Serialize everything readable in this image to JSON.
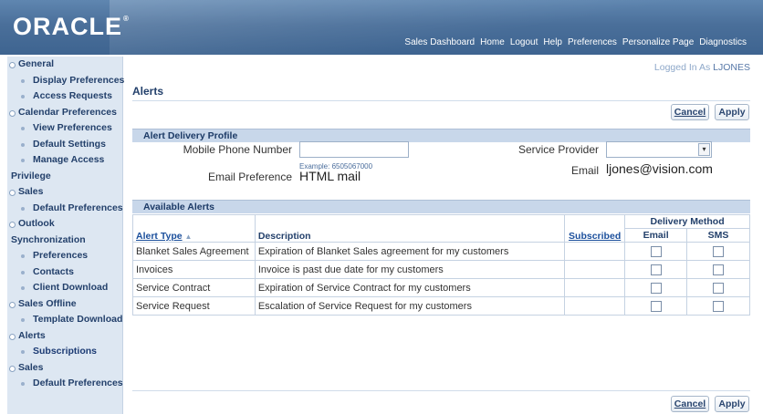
{
  "header": {
    "logo": "ORACLE",
    "logo_mark": "®",
    "nav": [
      "Sales Dashboard",
      "Home",
      "Logout",
      "Help",
      "Preferences",
      "Personalize Page",
      "Diagnostics"
    ]
  },
  "sidebar": {
    "items": [
      {
        "label": "General",
        "level": 1
      },
      {
        "label": "Display Preferences",
        "level": 2
      },
      {
        "label": "Access Requests",
        "level": 2
      },
      {
        "label": "Calendar Preferences",
        "level": 1
      },
      {
        "label": "View Preferences",
        "level": 2
      },
      {
        "label": "Default Settings",
        "level": 2
      },
      {
        "label": "Manage Access",
        "level": 2
      },
      {
        "label": "Privilege",
        "level": 0
      },
      {
        "label": "Sales",
        "level": 1
      },
      {
        "label": "Default Preferences",
        "level": 2
      },
      {
        "label": "Outlook",
        "level": 1
      },
      {
        "label": "Synchronization",
        "level": 0
      },
      {
        "label": "Preferences",
        "level": 2
      },
      {
        "label": "Contacts",
        "level": 2
      },
      {
        "label": "Client Download",
        "level": 2
      },
      {
        "label": "Sales Offline",
        "level": 1
      },
      {
        "label": "Template Download",
        "level": 2
      },
      {
        "label": "Alerts",
        "level": 1
      },
      {
        "label": "Subscriptions",
        "level": 2,
        "selected": true
      },
      {
        "label": "Sales",
        "level": 1
      },
      {
        "label": "Default Preferences",
        "level": 2
      }
    ]
  },
  "main": {
    "logged_in_prefix": "Logged In As ",
    "logged_in_user": "LJONES",
    "title": "Alerts",
    "cancel_label": "Cancel",
    "apply_label": "Apply",
    "delivery_profile": {
      "header": "Alert Delivery Profile",
      "mobile_label": "Mobile Phone Number",
      "mobile_value": "",
      "mobile_hint": "Example: 6505067000",
      "email_pref_label": "Email Preference",
      "email_pref_value": "HTML mail",
      "provider_label": "Service Provider",
      "provider_value": "",
      "email_label": "Email",
      "email_value": "ljones@vision.com"
    },
    "available_alerts": {
      "header": "Available Alerts",
      "columns": {
        "alert_type": "Alert Type",
        "description": "Description",
        "subscribed": "Subscribed",
        "delivery_method": "Delivery Method",
        "email": "Email",
        "sms": "SMS"
      },
      "rows": [
        {
          "type": "Blanket Sales Agreement",
          "description": "Expiration of Blanket Sales agreement for my customers",
          "email": false,
          "sms": false
        },
        {
          "type": "Invoices",
          "description": "Invoice is past due date for my customers",
          "email": false,
          "sms": false
        },
        {
          "type": "Service Contract",
          "description": "Expiration of Service Contract for my customers",
          "email": false,
          "sms": false
        },
        {
          "type": "Service Request",
          "description": "Escalation of Service Request for my customers",
          "email": false,
          "sms": false
        }
      ]
    }
  },
  "colors": {
    "header": "#4a6f9a",
    "sidebar_bg": "#dde7f2",
    "section_bar": "#c8d7ea",
    "link": "#1b4f9c"
  }
}
